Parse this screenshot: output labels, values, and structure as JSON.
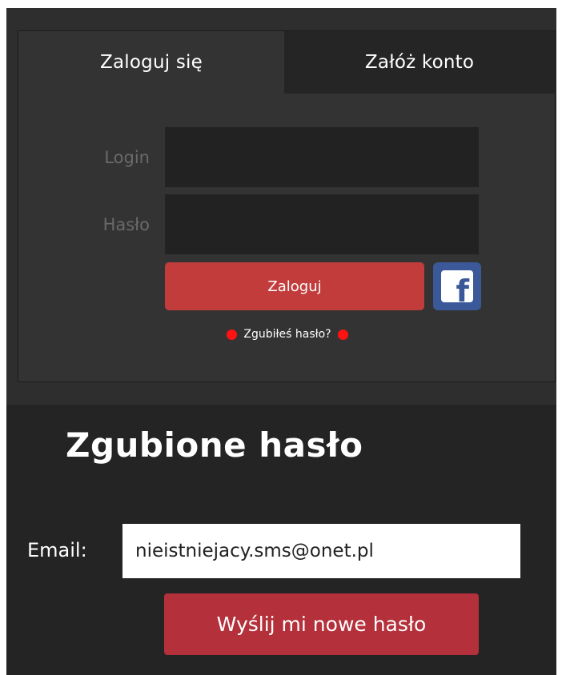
{
  "tabs": {
    "login_label": "Zaloguj się",
    "register_label": "Załóż konto"
  },
  "login_form": {
    "login_label": "Login",
    "login_value": "",
    "password_label": "Hasło",
    "password_value": "",
    "submit_label": "Zaloguj",
    "facebook_icon_glyph": "f",
    "forgot_label": "Zgubiłeś hasło?"
  },
  "recovery": {
    "title": "Zgubione hasło",
    "email_label": "Email:",
    "email_value": "nieistniejacy.sms@onet.pl",
    "send_label": "Wyślij mi nowe hasło"
  },
  "colors": {
    "accent_red": "#c23c3c",
    "dot_red": "#ff1212",
    "facebook_blue": "#3b5998",
    "panel_dark": "#333333",
    "background_dark": "#242424"
  },
  "icons": {
    "facebook": "facebook-icon",
    "dot": "red-dot-icon"
  }
}
